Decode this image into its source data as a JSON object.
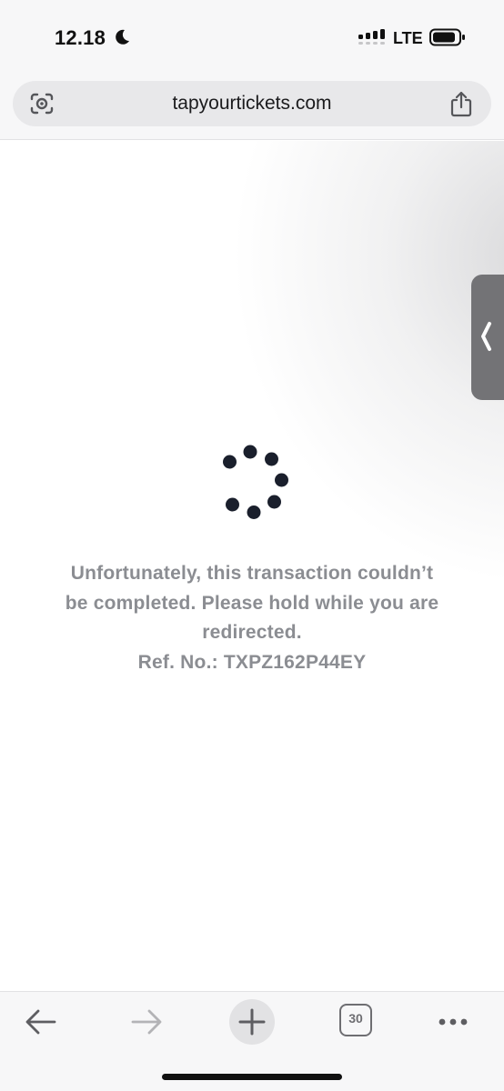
{
  "status_bar": {
    "time": "12.18",
    "network": "LTE",
    "icons": [
      "moon-icon",
      "signal-icon",
      "battery-icon"
    ]
  },
  "browser": {
    "url": "tapyourtickets.com",
    "icons": [
      "lens-icon",
      "share-icon",
      "chevron-left-icon"
    ]
  },
  "page": {
    "message_line1": "Unfortunately, this transaction couldn’t",
    "message_line2": "be completed. Please hold while you are",
    "message_line3": "redirected.",
    "reference": "Ref. No.: TXPZ162P44EY",
    "spinner_color": "#1a1f2c",
    "text_color": "#8b8d92"
  },
  "bottom_bar": {
    "tab_count": "30",
    "icons": [
      "back-arrow-icon",
      "forward-arrow-icon",
      "plus-icon",
      "tabs-icon",
      "more-icon"
    ]
  }
}
